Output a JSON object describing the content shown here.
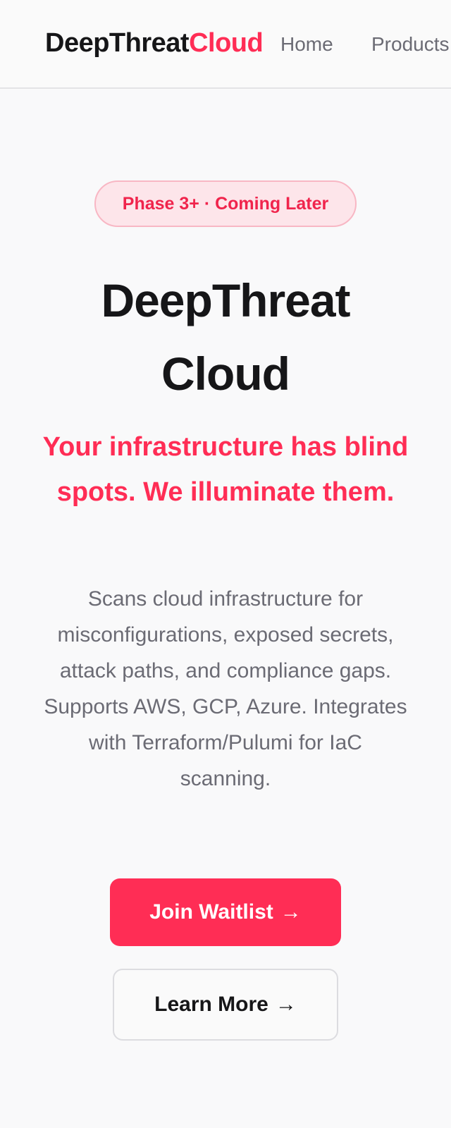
{
  "header": {
    "brand_primary": "DeepThreat",
    "brand_accent": "Cloud",
    "nav": {
      "home": "Home",
      "products": "Products"
    }
  },
  "hero": {
    "badge": "Phase 3+ · Coming Later",
    "title": "DeepThreat Cloud",
    "tagline": "Your infrastructure has blind spots. We illuminate them.",
    "description": "Scans cloud infrastructure for misconfigurations, exposed secrets, attack paths, and compliance gaps. Supports AWS, GCP, Azure. Integrates with Terraform/Pulumi for IaC scanning.",
    "primary_cta": "Join Waitlist",
    "secondary_cta": "Learn More",
    "cta_icon": "arrow-right-icon"
  },
  "colors": {
    "accent": "#ff2d55",
    "text_dark": "#161618",
    "text_muted": "#6b6b74",
    "badge_bg": "#fde5ea",
    "background": "#f9f9fa"
  }
}
